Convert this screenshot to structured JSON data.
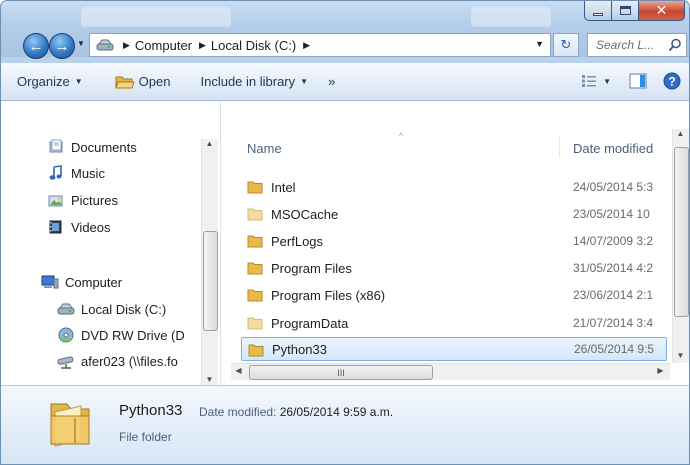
{
  "address": {
    "crumbs": [
      "Computer",
      "Local Disk (C:)"
    ]
  },
  "search": {
    "placeholder": "Search L..."
  },
  "toolbar": {
    "organize": "Organize",
    "open": "Open",
    "include_in_library": "Include in library",
    "more": "»"
  },
  "nav_pane": {
    "items": [
      {
        "label": "Documents",
        "icon": "documents-icon"
      },
      {
        "label": "Music",
        "icon": "music-icon"
      },
      {
        "label": "Pictures",
        "icon": "pictures-icon"
      },
      {
        "label": "Videos",
        "icon": "videos-icon"
      },
      {
        "label": "Computer",
        "icon": "computer-icon"
      },
      {
        "label": "Local Disk (C:)",
        "icon": "local-disk-icon"
      },
      {
        "label": "DVD RW Drive (D",
        "icon": "dvd-drive-icon"
      },
      {
        "label": "afer023 (\\\\files.fo",
        "icon": "network-drive-icon"
      }
    ]
  },
  "file_list": {
    "columns": {
      "name": "Name",
      "date_modified": "Date modified"
    },
    "rows": [
      {
        "name": "Intel",
        "date": "24/05/2014 5:3",
        "faded": false
      },
      {
        "name": "MSOCache",
        "date": "23/05/2014 10",
        "faded": true
      },
      {
        "name": "PerfLogs",
        "date": "14/07/2009 3:2",
        "faded": false
      },
      {
        "name": "Program Files",
        "date": "31/05/2014 4:2",
        "faded": false
      },
      {
        "name": "Program Files (x86)",
        "date": "23/06/2014 2:1",
        "faded": false
      },
      {
        "name": "ProgramData",
        "date": "21/07/2014 3:4",
        "faded": true
      },
      {
        "name": "Python33",
        "date": "26/05/2014 9:5",
        "faded": false,
        "selected": true
      }
    ],
    "hscroll_grip": "III"
  },
  "details": {
    "name": "Python33",
    "modified_label": "Date modified:",
    "modified_value": "26/05/2014 9:59 a.m.",
    "type": "File folder"
  },
  "colors": {
    "folder": "#e9b949",
    "folder_faded": "#f3dca0",
    "selection_border": "#84acdd",
    "close_button": "#c8452c"
  }
}
